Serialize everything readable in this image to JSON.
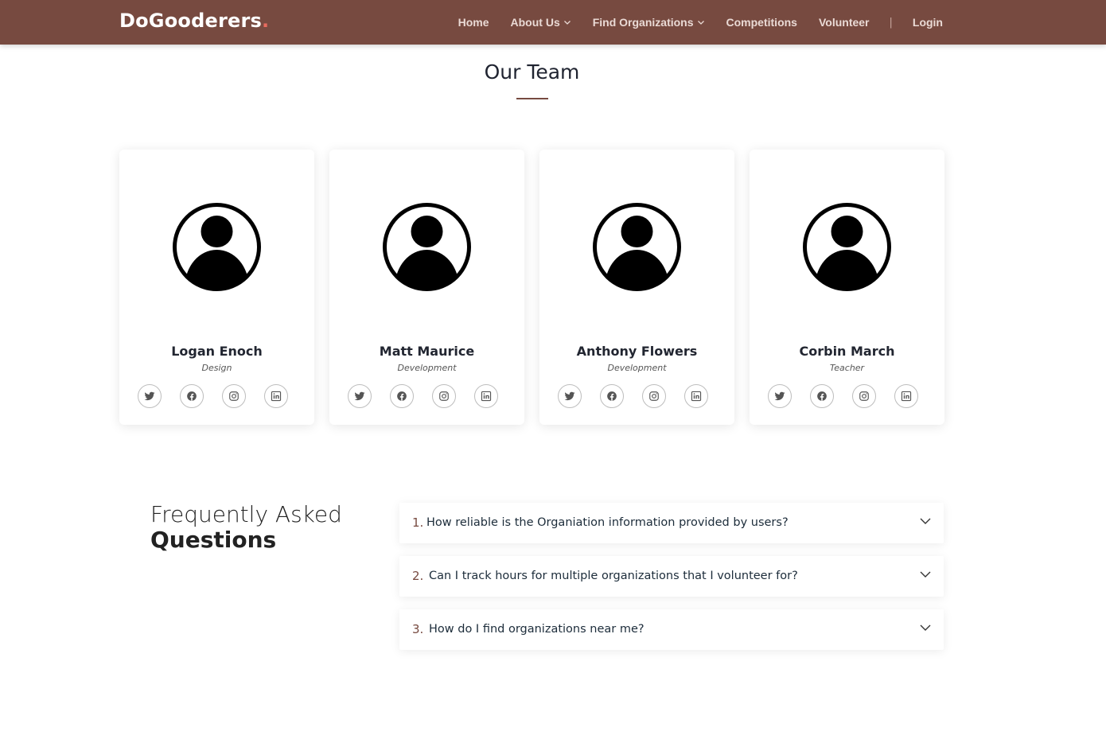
{
  "nav": {
    "brand": "DoGooderers",
    "brand_dot": ".",
    "links": [
      "Home",
      "About Us",
      "Find Organizations",
      "Competitions",
      "Volunteer"
    ],
    "separator": "|",
    "login": "Login"
  },
  "team": {
    "title": "Our Team",
    "members": [
      {
        "name": "Logan Enoch",
        "role": "Design"
      },
      {
        "name": "Matt Maurice",
        "role": "Development"
      },
      {
        "name": "Anthony Flowers",
        "role": "Development"
      },
      {
        "name": "Corbin March",
        "role": "Teacher"
      }
    ],
    "social_icons": [
      "twitter-icon",
      "facebook-icon",
      "instagram-icon",
      "linkedin-icon"
    ]
  },
  "faq": {
    "heading_light": "Frequently Asked",
    "heading_bold": "Questions",
    "items": [
      {
        "num": "1.",
        "question": "How reliable is the Organiation information provided by users?"
      },
      {
        "num": "2.",
        "question": "Can I track hours for multiple organizations that I volunteer for?"
      },
      {
        "num": "3.",
        "question": "How do I find organizations near me?"
      }
    ]
  },
  "colors": {
    "navbar": "#774a40",
    "accent": "#774a40",
    "logo_dot": "#e86b5f"
  }
}
